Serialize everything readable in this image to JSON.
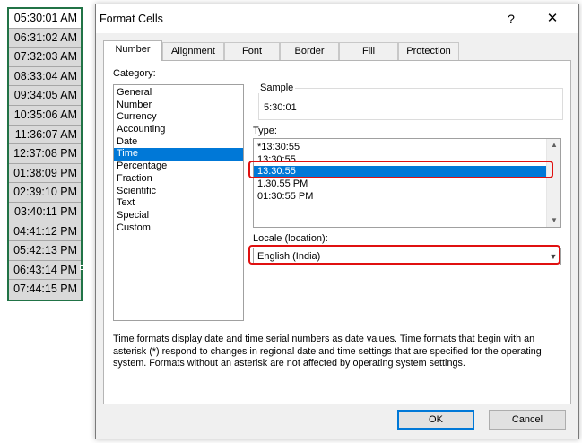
{
  "spreadsheet": {
    "cells": [
      "05:30:01 AM",
      "06:31:02 AM",
      "07:32:03 AM",
      "08:33:04 AM",
      "09:34:05 AM",
      "10:35:06 AM",
      "11:36:07 AM",
      "12:37:08 PM",
      "01:38:09 PM",
      "02:39:10 PM",
      "03:40:11 PM",
      "04:41:12 PM",
      "05:42:13 PM",
      "06:43:14 PM",
      "07:44:15 PM"
    ]
  },
  "dialog": {
    "title": "Format Cells",
    "help_glyph": "?",
    "close_glyph": "✕",
    "tabs": [
      "Number",
      "Alignment",
      "Font",
      "Border",
      "Fill",
      "Protection"
    ],
    "active_tab": "Number",
    "category_label": "Category:",
    "categories": [
      "General",
      "Number",
      "Currency",
      "Accounting",
      "Date",
      "Time",
      "Percentage",
      "Fraction",
      "Scientific",
      "Text",
      "Special",
      "Custom"
    ],
    "selected_category": "Time",
    "sample_label": "Sample",
    "sample_value": "5:30:01",
    "type_label": "Type:",
    "types": [
      "*13:30:55",
      "13:30:55",
      "13:30:55",
      "1.30.55 PM",
      "01:30:55 PM"
    ],
    "selected_type_index": 2,
    "locale_label": "Locale (location):",
    "locale_value": "English (India)",
    "description": "Time formats display date and time serial numbers as date values.  Time formats that begin with an asterisk (*) respond to changes in regional date and time settings that are specified for the operating system. Formats without an asterisk are not affected by operating system settings.",
    "ok_label": "OK",
    "cancel_label": "Cancel"
  },
  "colors": {
    "selection": "#0078d7",
    "highlight_border": "#e01010",
    "cell_fill": "#d9d9d9",
    "excel_green": "#217346"
  }
}
